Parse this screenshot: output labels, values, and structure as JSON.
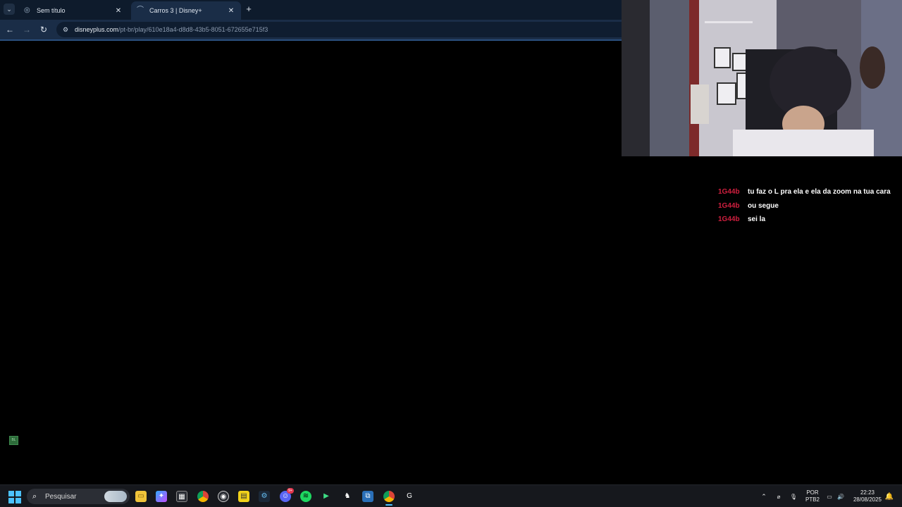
{
  "browser": {
    "tabs": [
      {
        "title": "Sem título",
        "active": false
      },
      {
        "title": "Carros 3 | Disney+",
        "active": true
      }
    ],
    "url_host": "disneyplus.com",
    "url_path": "/pt-br/play/610e18a4-d8d8-43b5-8051-672655e715f3"
  },
  "chat": {
    "messages": [
      {
        "user": "1G44b",
        "text": "tu faz o L pra ela e ela da zoom na tua cara"
      },
      {
        "user": "1G44b",
        "text": "ou segue"
      },
      {
        "user": "1G44b",
        "text": "sei la"
      }
    ]
  },
  "badge": {
    "text": "BL"
  },
  "taskbar": {
    "search_placeholder": "Pesquisar",
    "apps": [
      "file-explorer",
      "copilot",
      "microsoft-store",
      "chrome",
      "obs",
      "sticky-notes",
      "steam",
      "discord",
      "spotify",
      "android-studio",
      "sapo",
      "capcut",
      "chrome-active",
      "launcher"
    ],
    "discord_badge": "9+",
    "language_line1": "POR",
    "language_line2": "PTB2",
    "time": "22:23",
    "date": "28/08/2025"
  },
  "colors": {
    "chat_user": "#d11f3f",
    "accent": "#4cc2ff",
    "tabstrip_bg": "#0e1b2c",
    "toolbar_bg": "#1a2d47"
  }
}
